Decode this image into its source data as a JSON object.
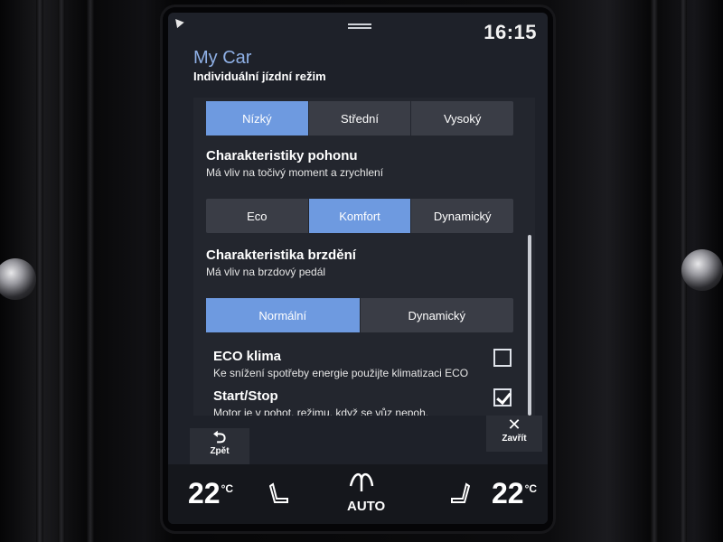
{
  "status": {
    "time": "16:15"
  },
  "header": {
    "app_title": "My Car",
    "subtitle": "Individuální jízdní režim"
  },
  "top_selector": {
    "options": [
      "Nízký",
      "Střední",
      "Vysoký"
    ],
    "selected": "Nízký"
  },
  "drive_characteristics": {
    "title": "Charakteristiky pohonu",
    "description": "Má vliv na točivý moment a zrychlení",
    "options": [
      "Eco",
      "Komfort",
      "Dynamický"
    ],
    "selected": "Komfort"
  },
  "brake_characteristics": {
    "title": "Charakteristika brzdění",
    "description": "Má vliv na brzdový pedál",
    "options": [
      "Normální",
      "Dynamický"
    ],
    "selected": "Normální"
  },
  "eco_climate": {
    "title": "ECO klima",
    "description": "Ke snížení spotřeby energie použijte klimatizaci ECO",
    "checked": false
  },
  "start_stop": {
    "title": "Start/Stop",
    "description": "Motor je v pohot. režimu, když se vůz nepoh.",
    "checked": true
  },
  "buttons": {
    "back_label": "Zpět",
    "close_label": "Zavřít"
  },
  "climate": {
    "left_temp": "22",
    "right_temp": "22",
    "unit": "°C",
    "mode": "AUTO",
    "icons": [
      "seat-heat-left-icon",
      "fan-icon",
      "seat-heat-right-icon"
    ]
  },
  "colors": {
    "accent": "#6e9ae0",
    "title": "#8fb0e6",
    "background": "#1e2129"
  }
}
